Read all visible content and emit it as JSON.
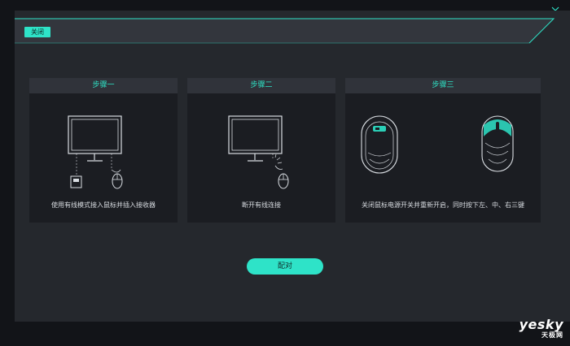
{
  "window": {
    "close_tab_label": "关闭",
    "controls": [
      "minimize-icon",
      "close-icon"
    ]
  },
  "steps": [
    {
      "title": "步骤一",
      "description": "使用有线模式接入鼠标并插入接收器"
    },
    {
      "title": "步骤二",
      "description": "断开有线连接"
    },
    {
      "title": "步骤三",
      "description": "关闭鼠标电源开关并重新开启，同时按下左、中、右三键"
    }
  ],
  "pair_button_label": "配对",
  "watermark": {
    "en": "yesky",
    "cn": "天极网"
  },
  "colors": {
    "accent": "#2ee3c8",
    "window_bg": "#25282d",
    "card_bg": "#1b1d22",
    "card_header_bg": "#30333a",
    "page_bg": "#121418"
  }
}
